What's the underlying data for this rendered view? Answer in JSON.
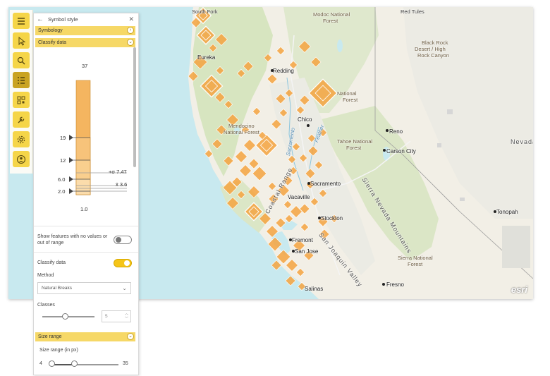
{
  "toolbar": {
    "buttons": [
      {
        "name": "menu-icon",
        "active": false
      },
      {
        "name": "pointer-icon",
        "active": false
      },
      {
        "name": "search-icon",
        "active": false
      },
      {
        "name": "list-icon",
        "active": true
      },
      {
        "name": "qr-grid-icon",
        "active": false
      },
      {
        "name": "wrench-icon",
        "active": false
      },
      {
        "name": "settings-icon",
        "active": false
      },
      {
        "name": "user-icon",
        "active": false
      }
    ],
    "accent_color": "#f5d548",
    "active_color": "#c9a322"
  },
  "panel": {
    "title": "Symbol style",
    "symbology_label": "Symbology",
    "classify_label": "Classify data",
    "histogram": {
      "max_label": "37",
      "min_label": "1.0",
      "breaks": [
        "19",
        "12",
        "6.0",
        "2.0"
      ],
      "stddev_label": "+σ 7.47",
      "mean_label": "x̄ 3.6"
    },
    "show_features_label": "Show features with no values or out of range",
    "show_features_on": false,
    "classify_toggle_label": "Classify data",
    "classify_on": true,
    "method_label": "Method",
    "method_value": "Natural Breaks",
    "classes_label": "Classes",
    "classes_value": "5",
    "size_range_section": "Size range",
    "size_range_label": "Size range (in px)",
    "size_min": "4",
    "size_max": "35"
  },
  "map": {
    "labels": {
      "south_fork": "South Fork",
      "modoc": "Modoc National",
      "forest": "Forest",
      "red_tules": "Red Tules",
      "black_rock": "Black Rock",
      "black_rock2": "Desert / High",
      "black_rock3": "Rock Canyon",
      "eureka": "Eureka",
      "redding": "Redding",
      "lassen": "National",
      "lassen2": "Forest",
      "chico": "Chico",
      "mendocino": "Mendocino",
      "mendocino2": "National Forest",
      "tahoe": "Tahoe National",
      "tahoe2": "Forest",
      "reno": "Reno",
      "carson": "Carson City",
      "nevada": "Nevada",
      "sacramento": "Sacramento",
      "vacaville": "Vacaville",
      "coastal": "Coastal Range",
      "sierra": "Sierra Nevada Mountains",
      "stockton": "Stockton",
      "sjv": "San Joaquin Valley",
      "fremont": "Fremont",
      "sanjose": "San Jose",
      "salinas": "Salinas",
      "fresno": "Fresno",
      "sierra_nf": "Sierra National",
      "sierra_nf2": "Forest",
      "tonopah": "Tonopah",
      "sacramento_river": "Sacramento",
      "feather": "Feather",
      "esri": "esri"
    },
    "symbol_color": "#f5a340",
    "water_color": "#c8e9ef",
    "land_color": "#f2efe6",
    "forest_color": "#d7e5c0"
  }
}
